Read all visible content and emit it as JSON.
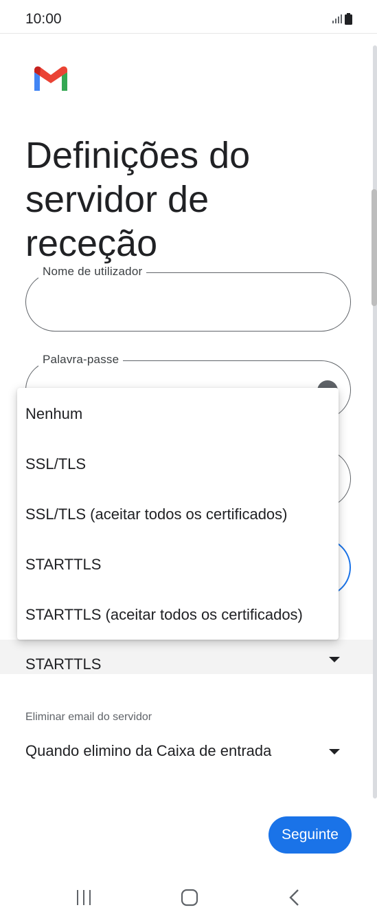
{
  "status_bar": {
    "time": "10:00"
  },
  "header": {
    "title": "Definições do servidor de receção"
  },
  "fields": {
    "username_label": "Nome de utilizador",
    "password_label": "Palavra-passe"
  },
  "security_dropdown": {
    "selected": "STARTTLS",
    "options": [
      "Nenhum",
      "SSL/TLS",
      "SSL/TLS (aceitar todos os certificados)",
      "STARTTLS",
      "STARTTLS (aceitar todos os certificados)"
    ]
  },
  "delete_email": {
    "label": "Eliminar email do servidor",
    "selected": "Quando elimino da Caixa de entrada"
  },
  "actions": {
    "next_label": "Seguinte"
  },
  "colors": {
    "accent": "#1a73e8",
    "gmail_red": "#ea4335",
    "gmail_blue": "#4285f4",
    "gmail_green": "#34a853",
    "gmail_yellow": "#fbbc04"
  }
}
